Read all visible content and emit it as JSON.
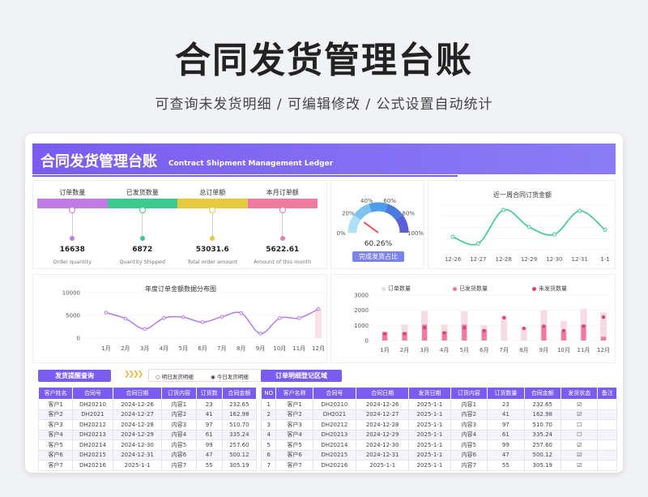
{
  "hero": {
    "title": "合同发货管理台账",
    "subtitle": "可查询未发货明细 /  可编辑修改  /  公式设置自动统计"
  },
  "banner": {
    "title": "合同发货管理台账",
    "subtitle_en": "Contract Shipment Management Ledger"
  },
  "kpis": [
    {
      "label": "订单数量",
      "value": "16638",
      "en": "Order quantity",
      "color": "#c27be6"
    },
    {
      "label": "已发货数量",
      "value": "6872",
      "en": "Quantity Shipped",
      "color": "#3cc98f"
    },
    {
      "label": "总订单额",
      "value": "53031.6",
      "en": "Total order amount",
      "color": "#e6c93c"
    },
    {
      "label": "本月订单额",
      "value": "5622.61",
      "en": "Amount of this month",
      "color": "#f07aa0"
    }
  ],
  "gauge": {
    "ticks": [
      "0%",
      "20%",
      "40%",
      "60%",
      "80%",
      "100%"
    ],
    "value_text": "60.26%",
    "value": 0.6026,
    "button": "完成发货占比"
  },
  "weekly": {
    "title": "近一周合同订货金额",
    "x": [
      "12-26",
      "12-27",
      "12-28",
      "12-29",
      "12-30",
      "12-31",
      "1-1"
    ],
    "values": [
      232.65,
      162.98,
      510.7,
      335.24,
      257.6,
      500.12,
      305.19
    ]
  },
  "annual": {
    "title": "年度订单金额数据分布图",
    "y_ticks": [
      "10000",
      "5000",
      "0"
    ],
    "ylim": [
      0,
      10000
    ],
    "x": [
      "1月",
      "2月",
      "3月",
      "4月",
      "5月",
      "6月",
      "7月",
      "8月",
      "9月",
      "10月",
      "11月",
      "12月"
    ],
    "values": [
      5600,
      4300,
      2000,
      4400,
      4600,
      3500,
      4700,
      5500,
      1000,
      4400,
      4400,
      6400
    ]
  },
  "shipping_chart": {
    "legend": [
      "订单数量",
      "已发货数量",
      "未发货数量"
    ],
    "y_ticks": [
      "3000",
      "2000",
      "1000",
      "0"
    ],
    "ylim": [
      0,
      3000
    ],
    "x": [
      "1月",
      "2月",
      "3月",
      "4月",
      "5月",
      "6月",
      "7月",
      "8月",
      "9月",
      "10月",
      "11月",
      "12月"
    ],
    "orders": [
      600,
      1050,
      1950,
      1050,
      1950,
      1000,
      1650,
      900,
      2000,
      1300,
      2100,
      1850
    ],
    "shipped": [
      550,
      550,
      1050,
      600,
      1050,
      700,
      0,
      0,
      1000,
      600,
      1050,
      250
    ],
    "unshipped": [
      450,
      450,
      850,
      500,
      850,
      650,
      1500,
      800,
      950,
      650,
      950,
      1550
    ]
  },
  "query": {
    "button": "发货提醒查询",
    "radio1": "明日发货明细",
    "radio2": "今日发货明细",
    "columns": [
      "客户姓名",
      "合同号",
      "合同日期",
      "订货内容",
      "订货数",
      "合同金额"
    ],
    "rows": [
      [
        "客户1",
        "DH20210",
        "2024-12-26",
        "内容1",
        "23",
        "232.65"
      ],
      [
        "客户2",
        "DH2021",
        "2024-12-27",
        "内容2",
        "41",
        "162.98"
      ],
      [
        "客户3",
        "DH20212",
        "2024-12-28",
        "内容3",
        "97",
        "510.70"
      ],
      [
        "客户4",
        "DH20213",
        "2024-12-29",
        "内容4",
        "61",
        "335.24"
      ],
      [
        "客户5",
        "DH20214",
        "2024-12-30",
        "内容5",
        "99",
        "257.60"
      ],
      [
        "客户6",
        "DH20215",
        "2024-12-31",
        "内容6",
        "47",
        "500.12"
      ],
      [
        "客户7",
        "DH20216",
        "2025-1-1",
        "内容7",
        "55",
        "305.19"
      ]
    ]
  },
  "ledger": {
    "button": "订单明细登记区域",
    "columns": [
      "NO",
      "客户名称",
      "合同号",
      "合同日期",
      "发货日期",
      "订货内容",
      "订货数量",
      "合同金额",
      "发货状态",
      "备注"
    ],
    "rows": [
      [
        "1",
        "客户1",
        "DH20210",
        "2024-12-26",
        "2025-1-1",
        "内容1",
        "23",
        "232.65",
        "☑",
        ""
      ],
      [
        "2",
        "客户2",
        "DH2021",
        "2024-12-27",
        "2025-1-1",
        "内容2",
        "41",
        "162.98",
        "☑",
        ""
      ],
      [
        "3",
        "客户3",
        "DH20212",
        "2024-12-28",
        "2025-1-1",
        "内容3",
        "97",
        "510.70",
        "☐",
        ""
      ],
      [
        "4",
        "客户4",
        "DH20213",
        "2024-12-29",
        "2025-1-1",
        "内容4",
        "61",
        "335.24",
        "☐",
        ""
      ],
      [
        "5",
        "客户5",
        "DH20214",
        "2024-12-30",
        "2025-1-1",
        "内容5",
        "99",
        "257.60",
        "☑",
        ""
      ],
      [
        "6",
        "客户6",
        "DH20215",
        "2024-12-31",
        "2025-1-1",
        "内容6",
        "47",
        "500.12",
        "☑",
        ""
      ],
      [
        "7",
        "客户7",
        "DH20216",
        "2025-1-1",
        "2025-1-1",
        "内容7",
        "55",
        "305.19",
        "☑",
        ""
      ]
    ]
  }
}
